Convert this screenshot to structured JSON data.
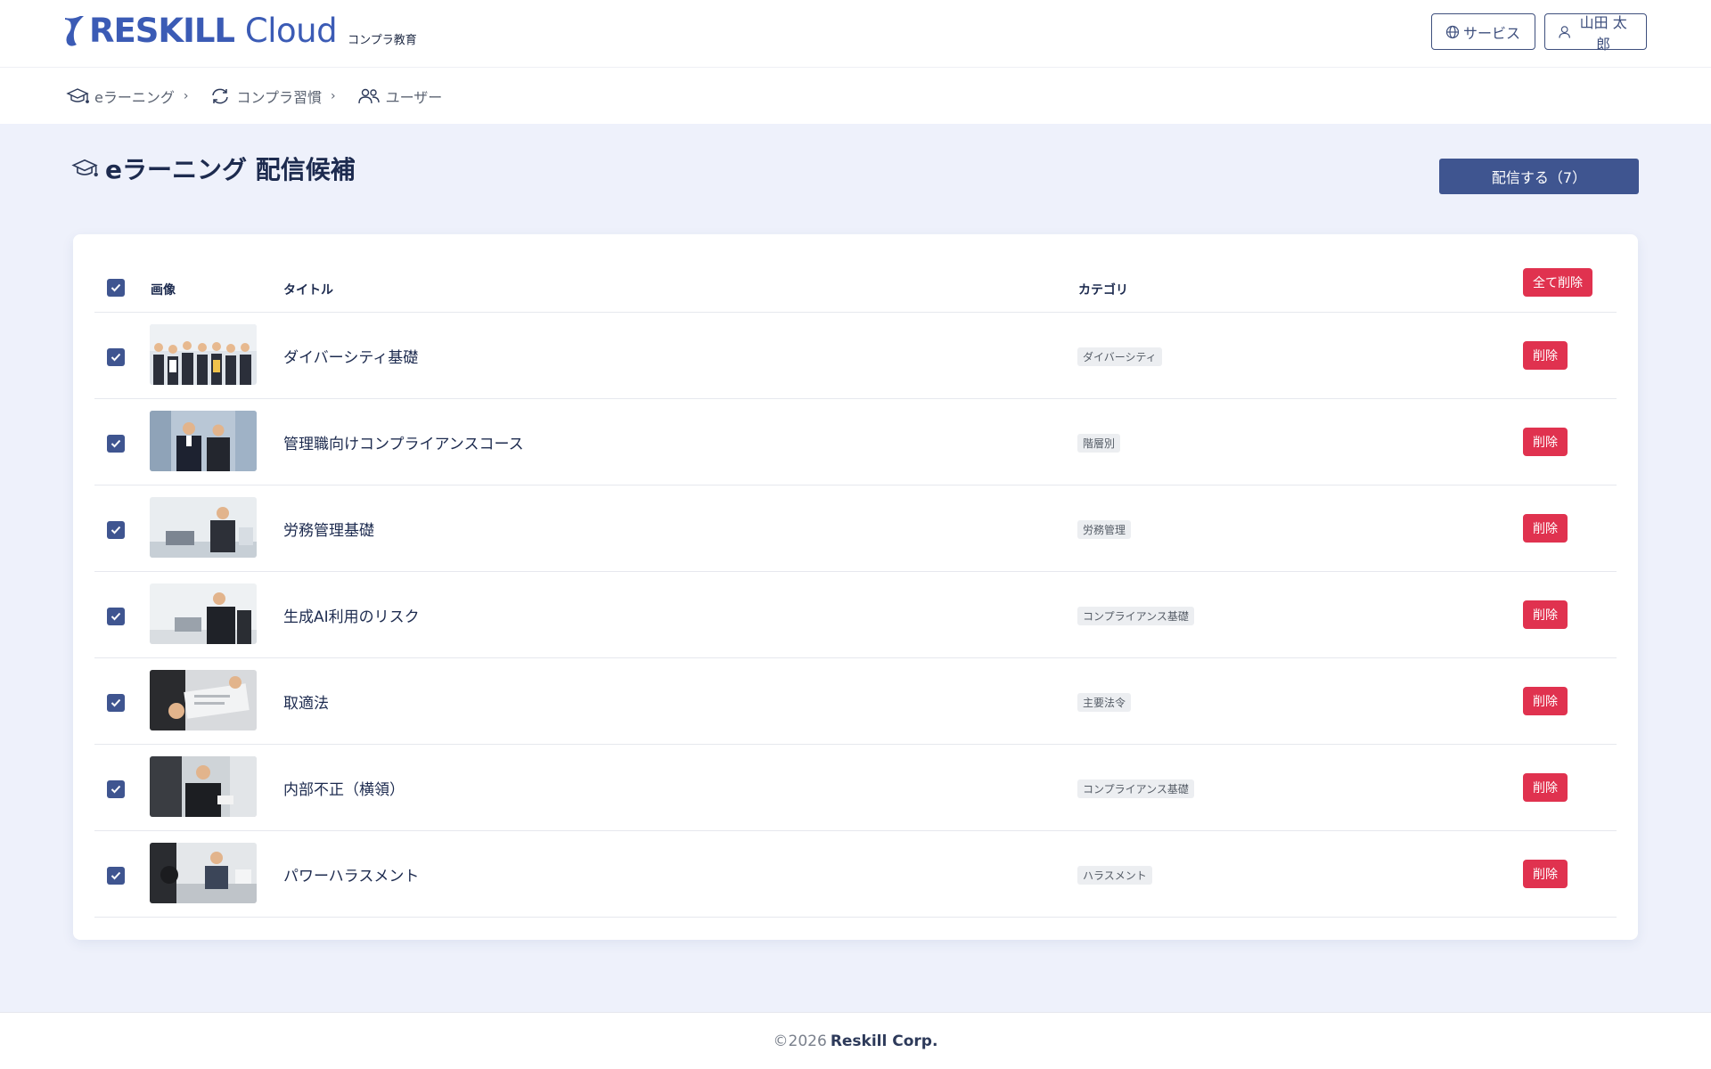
{
  "header": {
    "logo_bold": "RESKILL",
    "logo_light": "Cloud",
    "logo_sub": "コンプラ教育",
    "service_label": "サービス",
    "user_label": "山田 太郎"
  },
  "breadcrumb": [
    {
      "label": "eラーニング",
      "icon": "graduation-cap-icon"
    },
    {
      "label": "コンプラ習慣",
      "icon": "refresh-icon"
    },
    {
      "label": "ユーザー",
      "icon": "users-icon"
    }
  ],
  "page": {
    "title": "eラーニング 配信候補",
    "deliver_label": "配信する（7）"
  },
  "table": {
    "headers": {
      "image": "画像",
      "title": "タイトル",
      "category": "カテゴリ"
    },
    "delete_all_label": "全て削除",
    "delete_label": "削除",
    "rows": [
      {
        "title": "ダイバーシティ基礎",
        "category": "ダイバーシティ"
      },
      {
        "title": "管理職向けコンプライアンスコース",
        "category": "階層別"
      },
      {
        "title": "労務管理基礎",
        "category": "労務管理"
      },
      {
        "title": "生成AI利用のリスク",
        "category": "コンプライアンス基礎"
      },
      {
        "title": "取適法",
        "category": "主要法令"
      },
      {
        "title": "内部不正（横領）",
        "category": "コンプライアンス基礎"
      },
      {
        "title": "パワーハラスメント",
        "category": "ハラスメント"
      }
    ]
  },
  "footer": {
    "copyright": "©2026",
    "company": "Reskill Corp."
  },
  "colors": {
    "primary": "#3f5590",
    "danger": "#e0324f",
    "background": "#eef1fb",
    "logo": "#3b5bb5"
  }
}
